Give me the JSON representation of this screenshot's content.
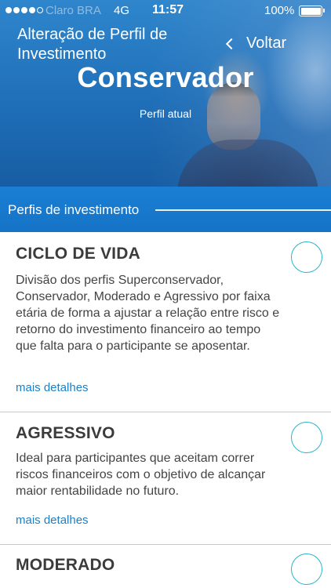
{
  "status_bar": {
    "carrier": "Claro BRA",
    "network": "4G",
    "time": "11:57",
    "battery": "100%"
  },
  "header": {
    "title": "Alteração de Perfil de Investimento",
    "back_label": "Voltar",
    "current_profile": "Conservador",
    "current_profile_caption": "Perfil atual"
  },
  "section": {
    "label": "Perfis de investimento"
  },
  "profiles": [
    {
      "title": "CICLO DE VIDA",
      "description": "Divisão dos perfis Superconservador, Conservador, Moderado e Agressivo por faixa etária de forma a ajustar a relação entre risco e retorno do investimento financeiro ao tempo que falta para o participante se aposentar.",
      "link": "mais detalhes"
    },
    {
      "title": "AGRESSIVO",
      "description": "Ideal para participantes que aceitam correr riscos financeiros com o objetivo de alcançar maior rentabilidade no futuro.",
      "link": "mais detalhes"
    },
    {
      "title": "MODERADO",
      "description": "",
      "link": ""
    }
  ],
  "colors": {
    "header_blue": "#1f6fb8",
    "section_blue": "#1a7fd4",
    "radio_accent": "#2ab5c9",
    "link_blue": "#1d7fc4"
  }
}
